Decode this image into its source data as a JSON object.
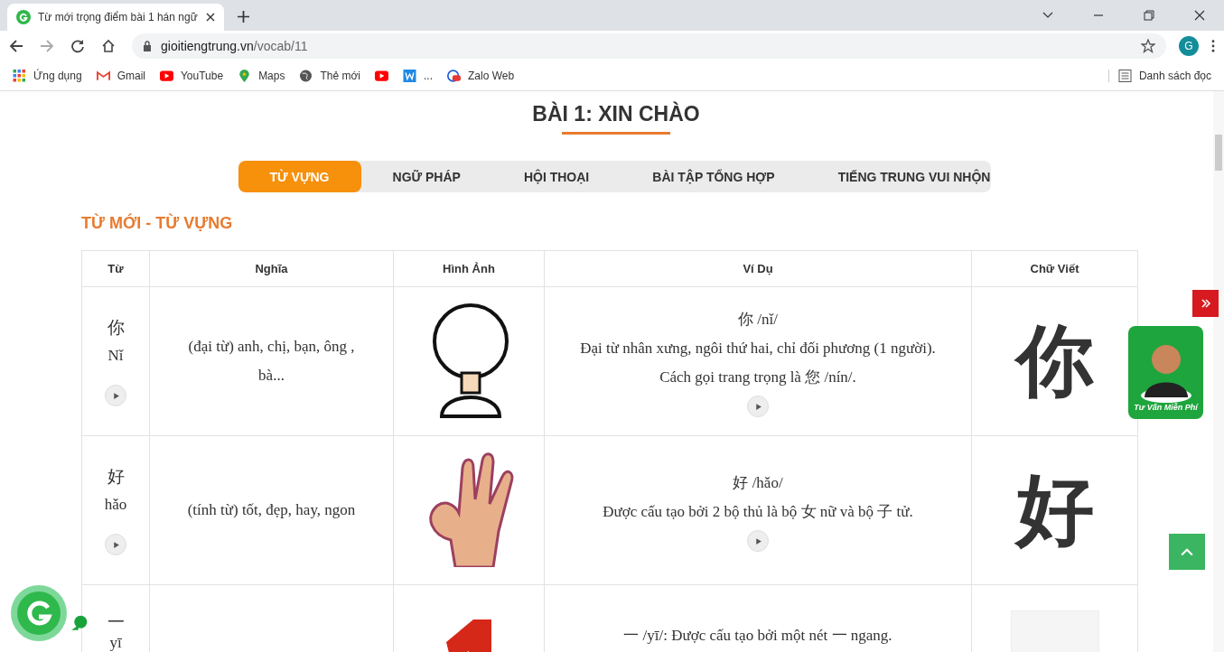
{
  "browser": {
    "tab_title": "Từ mới trọng điểm bài 1 hán ngữ",
    "url_host": "gioitiengtrung.vn",
    "url_path": "/vocab/11",
    "profile": "G",
    "bookmarks": [
      {
        "kind": "apps",
        "label": "Ứng dụng"
      },
      {
        "kind": "gmail",
        "label": "Gmail"
      },
      {
        "kind": "youtube",
        "label": "YouTube"
      },
      {
        "kind": "maps",
        "label": "Maps"
      },
      {
        "kind": "globe",
        "label": "Thẻ mới"
      },
      {
        "kind": "youtube"
      },
      {
        "kind": "word",
        "label": "..."
      },
      {
        "kind": "zalo",
        "label": "Zalo Web"
      }
    ],
    "reading_list": "Danh sách đọc"
  },
  "page": {
    "title": "BÀI 1: XIN CHÀO",
    "tabs": [
      {
        "label": "TỪ VỰNG",
        "selected": true
      },
      {
        "label": "NGỮ PHÁP",
        "selected": false
      },
      {
        "label": "HỘI THOẠI",
        "selected": false
      },
      {
        "label": "BÀI TẬP TỔNG HỢP",
        "selected": false
      },
      {
        "label": "TIẾNG TRUNG VUI NHỘN",
        "selected": false
      }
    ],
    "section_title": "TỪ MỚI - TỪ VỰNG",
    "table": {
      "columns": [
        "Từ",
        "Nghĩa",
        "Hình Ảnh",
        "Ví Dụ",
        "Chữ Viết"
      ],
      "rows": [
        {
          "word": "你",
          "pinyin": "Nǐ",
          "meaning": "(đại từ) anh, chị, bạn, ông , bà...",
          "example_head": "你 /nǐ/",
          "example_lines": [
            "Đại từ nhân xưng, ngôi thứ hai, chỉ đối phương (1 người).",
            "Cách gọi trang trọng là 您 /nín/."
          ],
          "stroke_char": "你"
        },
        {
          "word": "好",
          "pinyin": "hǎo",
          "meaning": "(tính từ) tốt, đẹp, hay, ngon",
          "example_head": "好 /hǎo/",
          "example_lines": [
            "Được cấu tạo bởi 2 bộ thủ là bộ 女 nữ và bộ 子 tử."
          ],
          "stroke_char": "好"
        },
        {
          "word": "一",
          "pinyin": "yī",
          "example_lines": [
            "一 /yī/: Được cấu tạo bởi một nét 一 ngang."
          ]
        }
      ]
    }
  },
  "consult": {
    "label": "Tư Vấn Miễn Phí"
  }
}
